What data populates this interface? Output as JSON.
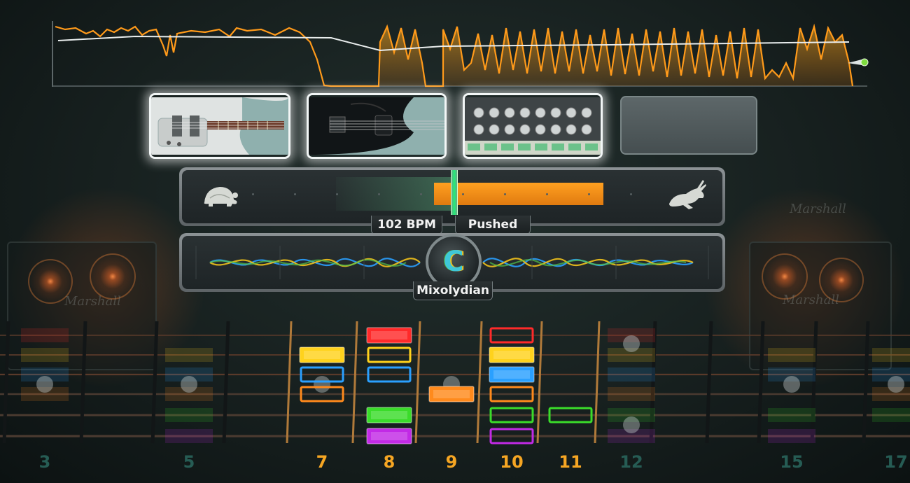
{
  "tempo": {
    "bpm_label": "102 BPM",
    "feel_label": "Pushed",
    "slow_icon": "turtle-icon",
    "fast_icon": "rabbit-icon"
  },
  "key": {
    "root": "C",
    "scale": "Mixolydian"
  },
  "instruments": [
    {
      "name": "electric-guitar",
      "active": true
    },
    {
      "name": "bass-guitar",
      "active": true
    },
    {
      "name": "drum-machine",
      "active": true
    },
    {
      "name": "empty-slot",
      "active": false
    }
  ],
  "fret_numbers": [
    {
      "label": "3",
      "active": false
    },
    {
      "label": "5",
      "active": false
    },
    {
      "label": "7",
      "active": true
    },
    {
      "label": "8",
      "active": true
    },
    {
      "label": "9",
      "active": true
    },
    {
      "label": "10",
      "active": true
    },
    {
      "label": "11",
      "active": true
    },
    {
      "label": "12",
      "active": false
    },
    {
      "label": "15",
      "active": false
    },
    {
      "label": "17",
      "active": false
    }
  ],
  "string_colors": [
    "#ff2a2a",
    "#ffd21c",
    "#2aa0ff",
    "#ff8a1c",
    "#3adc2a",
    "#c22ae6"
  ],
  "note_markers": [
    {
      "fret": "7",
      "string": 2,
      "filled": true
    },
    {
      "fret": "7",
      "string": 3,
      "filled": false
    },
    {
      "fret": "7",
      "string": 4,
      "filled": false
    },
    {
      "fret": "8",
      "string": 1,
      "filled": true
    },
    {
      "fret": "8",
      "string": 2,
      "filled": false
    },
    {
      "fret": "8",
      "string": 3,
      "filled": false
    },
    {
      "fret": "8",
      "string": 5,
      "filled": true
    },
    {
      "fret": "8",
      "string": 6,
      "filled": true
    },
    {
      "fret": "9",
      "string": 4,
      "filled": true
    },
    {
      "fret": "10",
      "string": 1,
      "filled": false
    },
    {
      "fret": "10",
      "string": 2,
      "filled": true
    },
    {
      "fret": "10",
      "string": 3,
      "filled": true
    },
    {
      "fret": "10",
      "string": 4,
      "filled": false
    },
    {
      "fret": "10",
      "string": 5,
      "filled": false
    },
    {
      "fret": "10",
      "string": 6,
      "filled": false
    },
    {
      "fret": "11",
      "string": 5,
      "filled": false
    }
  ],
  "colors": {
    "accent_orange": "#f6a623",
    "accent_cyan": "#3fc7d9",
    "history_line": "#ff9a1a"
  }
}
